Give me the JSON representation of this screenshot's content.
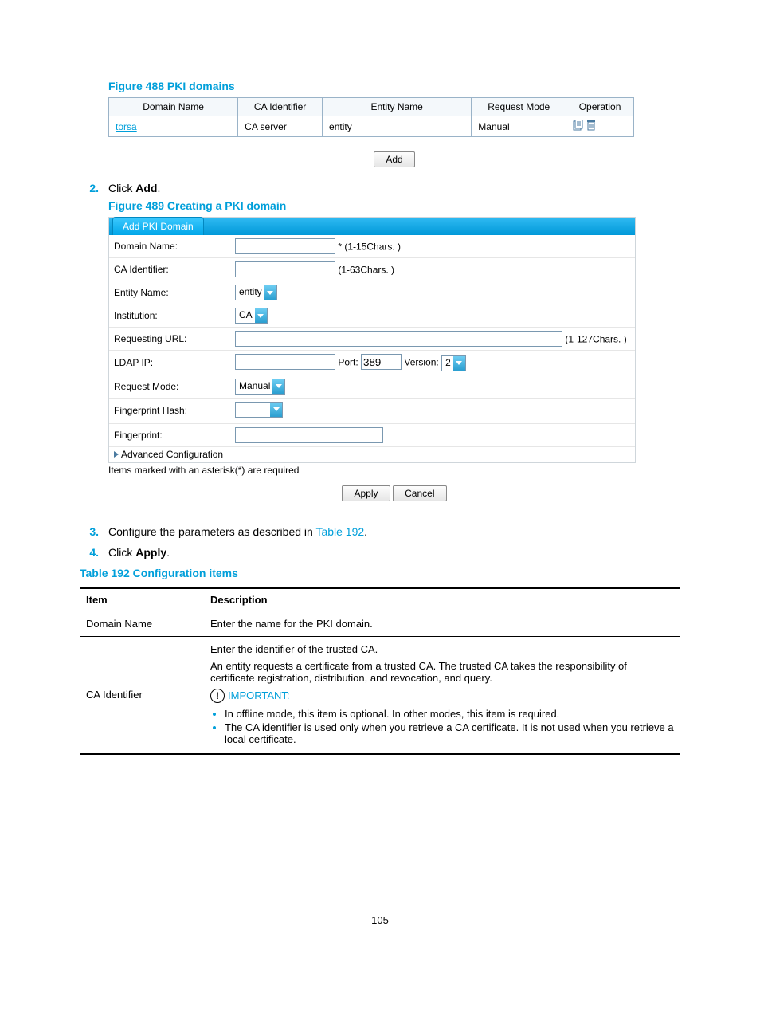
{
  "figure488": {
    "caption": "Figure 488 PKI domains",
    "headers": {
      "domain": "Domain Name",
      "ca": "CA Identifier",
      "entity": "Entity Name",
      "mode": "Request Mode",
      "op": "Operation"
    },
    "row": {
      "domain": "torsa",
      "ca": "CA server",
      "entity": "entity",
      "mode": "Manual"
    },
    "add_button": "Add"
  },
  "step2": {
    "num": "2.",
    "prefix": "Click ",
    "bold": "Add",
    "suffix": "."
  },
  "figure489": {
    "caption": "Figure 489 Creating a PKI domain",
    "tab": "Add PKI Domain",
    "labels": {
      "domain": "Domain Name:",
      "ca": "CA Identifier:",
      "entity": "Entity Name:",
      "institution": "Institution:",
      "requrl": "Requesting URL:",
      "ldap": "LDAP IP:",
      "port_lbl": "Port:",
      "port_val": "389",
      "ver_lbl": "Version:",
      "ver_val": "2",
      "reqmode": "Request Mode:",
      "fphash": "Fingerprint Hash:",
      "fp": "Fingerprint:",
      "adv": "Advanced Configuration"
    },
    "hints": {
      "domain": "* (1-15Chars. )",
      "ca": "(1-63Chars. )",
      "requrl": "(1-127Chars. )"
    },
    "values": {
      "entity": "entity",
      "institution": "CA",
      "reqmode": "Manual"
    },
    "note": "Items marked with an asterisk(*) are required",
    "apply": "Apply",
    "cancel": "Cancel"
  },
  "step3": {
    "num": "3.",
    "prefix": "Configure the parameters as described in ",
    "link": "Table 192",
    "suffix": "."
  },
  "step4": {
    "num": "4.",
    "prefix": "Click ",
    "bold": "Apply",
    "suffix": "."
  },
  "table192": {
    "caption": "Table 192 Configuration items",
    "headers": {
      "item": "Item",
      "desc": "Description"
    },
    "row1": {
      "item": "Domain Name",
      "desc": "Enter the name for the PKI domain."
    },
    "row2": {
      "item": "CA Identifier",
      "p1": "Enter the identifier of the trusted CA.",
      "p2": "An entity requests a certificate from a trusted CA. The trusted CA takes the responsibility of certificate registration, distribution, and revocation, and query.",
      "important": "IMPORTANT:",
      "b1": "In offline mode, this item is optional. In other modes, this item is required.",
      "b2": "The CA identifier is used only when you retrieve a CA certificate. It is not used when you retrieve a local certificate."
    }
  },
  "page_number": "105"
}
